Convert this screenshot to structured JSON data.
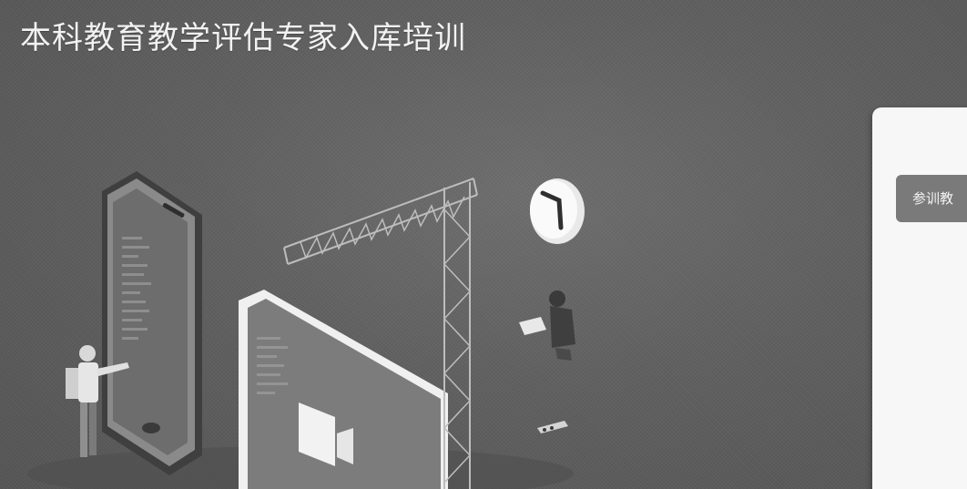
{
  "page": {
    "title": "本科教育教学评估专家入库培训"
  },
  "login_panel": {
    "tab_label": "参训教"
  },
  "colors": {
    "background": "#5d5d5d",
    "title_text": "#f2f2f2",
    "panel_bg": "#f7f7f7",
    "tab_bg": "#7a7a7a"
  },
  "illustration": {
    "icons": [
      "smartphone-icon",
      "tablet-screen-icon",
      "video-camera-icon",
      "clock-icon",
      "crane-truss-icon",
      "presenter-figure",
      "seated-person-figure"
    ]
  }
}
